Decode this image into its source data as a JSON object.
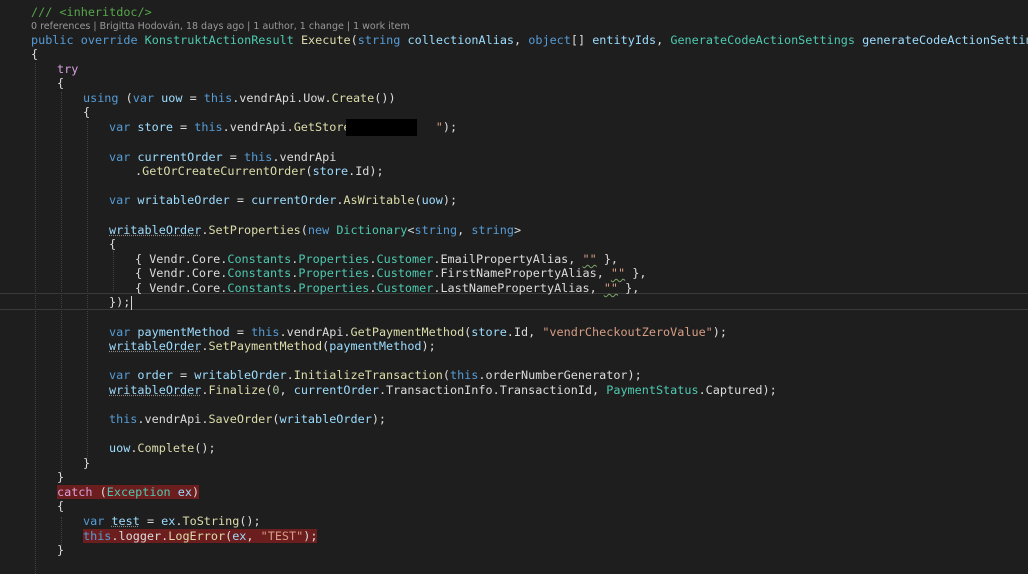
{
  "codelens": "0 references | Brigitta Hodován, 18 days ago | 1 author, 1 change | 1 work item",
  "colors": {
    "background": "#1e1e1e",
    "keyword": "#569cd6",
    "control_keyword": "#d8a0df",
    "type": "#4ec9b0",
    "method": "#dcdcaa",
    "variable": "#9cdcfe",
    "string": "#d69d85",
    "comment": "#57a64a",
    "breakpoint_highlight": "#6c1e1e"
  },
  "code": {
    "l00": {
      "t0": "/// <inheritdoc/>"
    },
    "l01": {
      "t0": "public",
      "t1": " ",
      "t2": "override",
      "t3": " ",
      "t4": "KonstruktActionResult",
      "t5": " ",
      "t6": "Execute",
      "t7": "(",
      "t8": "string",
      "t9": " ",
      "t10": "collectionAlias",
      "t11": ", ",
      "t12": "object",
      "t13": "[] ",
      "t14": "entityIds",
      "t15": ", ",
      "t16": "GenerateCodeActionSettings",
      "t17": " ",
      "t18": "generateCodeActionSettings",
      "t19": ")"
    },
    "l02": {
      "t0": "{"
    },
    "l03": {
      "t0": "try"
    },
    "l04": {
      "t0": "{"
    },
    "l05": {
      "t0": "using",
      "t1": " (",
      "t2": "var",
      "t3": " ",
      "t4": "uow",
      "t5": " = ",
      "t6": "this",
      "t7": ".vendrApi.Uow.",
      "t8": "Create",
      "t9": "())"
    },
    "l06": {
      "t0": "{"
    },
    "l07": {
      "t0": "var",
      "t1": " ",
      "t2": "store",
      "t3": " = ",
      "t4": "this",
      "t5": ".vendrApi.",
      "t6": "GetStore",
      "t7": "(",
      "t8": "\"",
      "t9": "\"",
      "t10": ");"
    },
    "l08": {
      "t0": "var",
      "t1": " ",
      "t2": "currentOrder",
      "t3": " = ",
      "t4": "this",
      "t5": ".vendrApi"
    },
    "l09": {
      "t0": ".",
      "t1": "GetOrCreateCurrentOrder",
      "t2": "(",
      "t3": "store",
      "t4": ".Id);"
    },
    "l10": {
      "t0": "var",
      "t1": " ",
      "t2": "writableOrder",
      "t3": " = ",
      "t4": "currentOrder",
      "t5": ".",
      "t6": "AsWritable",
      "t7": "(",
      "t8": "uow",
      "t9": ");"
    },
    "l11": {
      "t0": "writableOrder",
      "t1": ".",
      "t2": "SetProperties",
      "t3": "(",
      "t4": "new",
      "t5": " ",
      "t6": "Dictionary",
      "t7": "<",
      "t8": "string",
      "t9": ", ",
      "t10": "string",
      "t11": ">"
    },
    "l12": {
      "t0": "{"
    },
    "l13": {
      "t0": "{ Vendr.Core.",
      "t1": "Constants",
      "t2": ".",
      "t3": "Properties",
      "t4": ".",
      "t5": "Customer",
      "t6": ".EmailPropertyAlias, ",
      "t7": "\"\"",
      "t8": " },"
    },
    "l14": {
      "t0": "{ Vendr.Core.",
      "t1": "Constants",
      "t2": ".",
      "t3": "Properties",
      "t4": ".",
      "t5": "Customer",
      "t6": ".FirstNamePropertyAlias, ",
      "t7": "\"\"",
      "t8": " },"
    },
    "l15": {
      "t0": "{ Vendr.Core.",
      "t1": "Constants",
      "t2": ".",
      "t3": "Properties",
      "t4": ".",
      "t5": "Customer",
      "t6": ".LastNamePropertyAlias, ",
      "t7": "\"\"",
      "t8": " },"
    },
    "l16": {
      "t0": "});"
    },
    "l17": {
      "t0": "var",
      "t1": " ",
      "t2": "paymentMethod",
      "t3": " = ",
      "t4": "this",
      "t5": ".vendrApi.",
      "t6": "GetPaymentMethod",
      "t7": "(",
      "t8": "store",
      "t9": ".Id, ",
      "t10": "\"vendrCheckoutZeroValue\"",
      "t11": ");"
    },
    "l18": {
      "t0": "writableOrder",
      "t1": ".",
      "t2": "SetPaymentMethod",
      "t3": "(",
      "t4": "paymentMethod",
      "t5": ");"
    },
    "l19": {
      "t0": "var",
      "t1": " ",
      "t2": "order",
      "t3": " = ",
      "t4": "writableOrder",
      "t5": ".",
      "t6": "InitializeTransaction",
      "t7": "(",
      "t8": "this",
      "t9": ".orderNumberGenerator);"
    },
    "l20": {
      "t0": "writableOrder",
      "t1": ".",
      "t2": "Finalize",
      "t3": "(",
      "t4": "0",
      "t5": ", ",
      "t6": "currentOrder",
      "t7": ".TransactionInfo.TransactionId, ",
      "t8": "PaymentStatus",
      "t9": ".Captured);"
    },
    "l21": {
      "t0": "this",
      "t1": ".vendrApi.",
      "t2": "SaveOrder",
      "t3": "(",
      "t4": "writableOrder",
      "t5": ");"
    },
    "l22": {
      "t0": "uow",
      "t1": ".",
      "t2": "Complete",
      "t3": "();"
    },
    "l23": {
      "t0": "}"
    },
    "l24": {
      "t0": "}"
    },
    "l25": {
      "t0": "catch",
      "t1": " (",
      "t2": "Exception",
      "t3": " ",
      "t4": "ex",
      "t5": ")"
    },
    "l26": {
      "t0": "{"
    },
    "l27": {
      "t0": "var",
      "t1": " ",
      "t2": "test",
      "t3": " = ",
      "t4": "ex",
      "t5": ".",
      "t6": "ToString",
      "t7": "();"
    },
    "l28": {
      "t0": "this",
      "t1": ".logger.",
      "t2": "LogError",
      "t3": "(",
      "t4": "ex",
      "t5": ", ",
      "t6": "\"TEST\"",
      "t7": ");"
    },
    "l29": {
      "t0": "}"
    }
  }
}
